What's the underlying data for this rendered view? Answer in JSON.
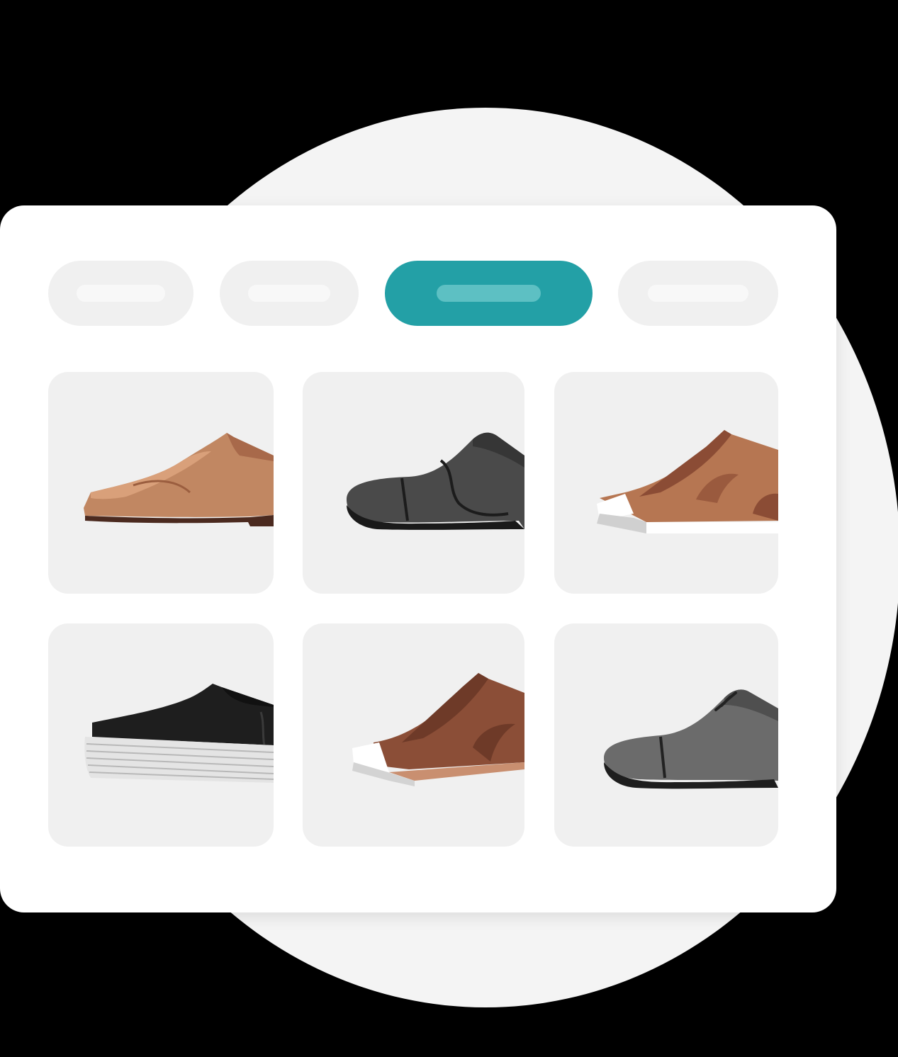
{
  "colors": {
    "page_background": "#000000",
    "circle": "#f4f4f4",
    "window": "#ffffff",
    "tab_inactive": "#f0f0f0",
    "tab_active": "#23a0a6",
    "tab_active_bar": "#5dc0c3",
    "card": "#f0f0f0"
  },
  "filter_tabs": [
    {
      "id": "tab-1",
      "active": false
    },
    {
      "id": "tab-2",
      "active": false
    },
    {
      "id": "tab-3",
      "active": true
    },
    {
      "id": "tab-4",
      "active": false
    }
  ],
  "products": [
    {
      "icon": "tan-loafer-icon"
    },
    {
      "icon": "black-oxford-icon"
    },
    {
      "icon": "brown-sneaker-icon"
    },
    {
      "icon": "black-platform-sneaker-icon"
    },
    {
      "icon": "brown-slip-on-icon"
    },
    {
      "icon": "gray-derby-shoe-icon"
    }
  ]
}
